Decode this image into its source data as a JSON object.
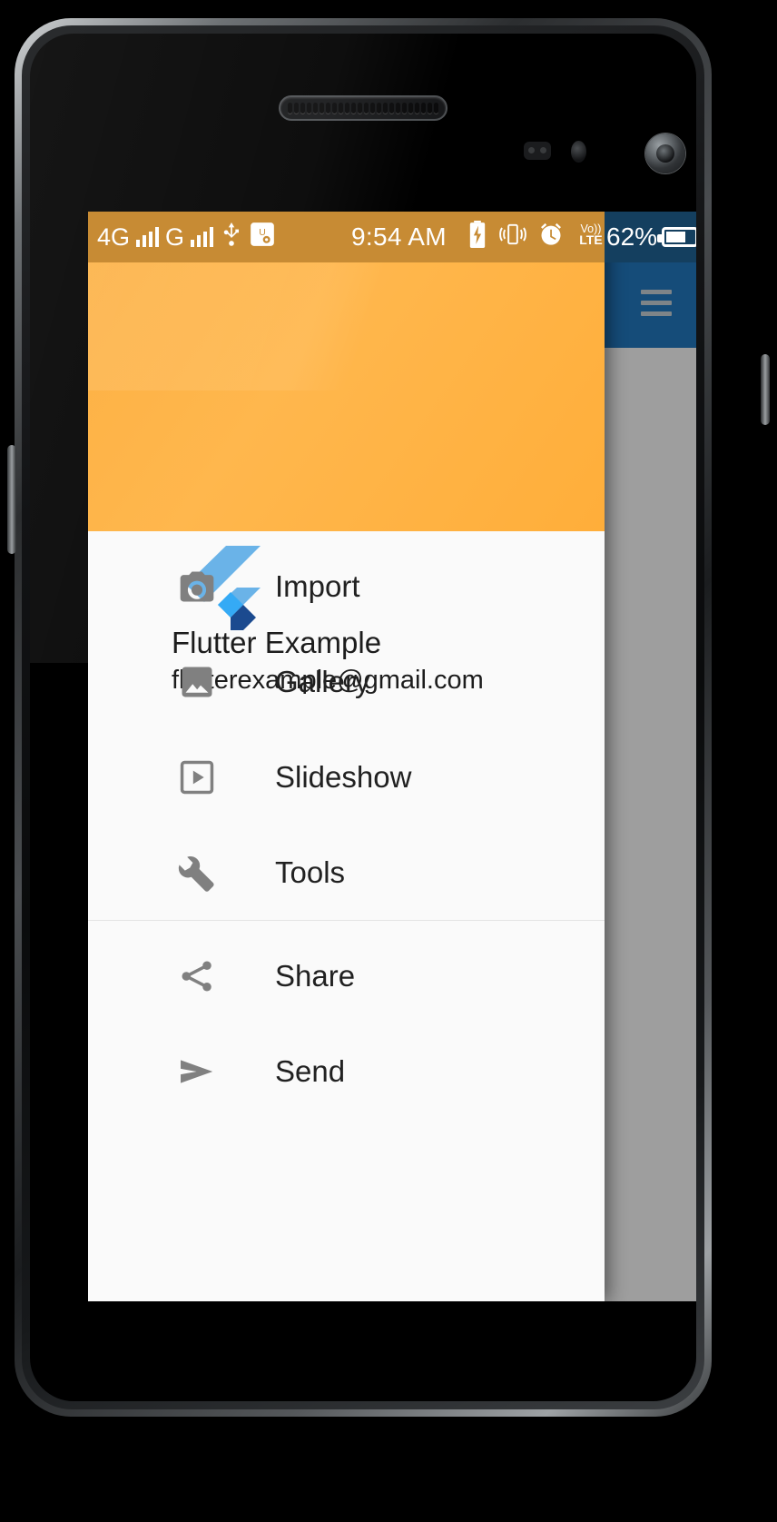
{
  "device": {
    "frame": "android-phone",
    "elements": [
      "earpiece-speaker",
      "proximity-sensor",
      "light-sensor",
      "front-camera"
    ]
  },
  "status_bar": {
    "network_1": "4G",
    "network_2": "G",
    "usb_icon": "usb-icon",
    "usb_debug_icon": "usb-debugging-icon",
    "time": "9:54 AM",
    "charging_icon": "battery-charging-icon",
    "vibrate_icon": "vibrate-icon",
    "alarm_icon": "alarm-clock-icon",
    "volte_top": "Vo))",
    "volte_bottom": "LTE",
    "battery_percent": "62%",
    "battery_level": 62
  },
  "app_bar": {
    "menu_icon": "hamburger-menu-icon",
    "background_color": "#154c79"
  },
  "drawer": {
    "header": {
      "logo": "flutter-logo",
      "name": "Flutter Example",
      "email": "flutterexample@gmail.com",
      "background_color": "#ffb74d"
    },
    "items": [
      {
        "label": "Import",
        "icon": "camera-icon"
      },
      {
        "label": "Gallery",
        "icon": "image-icon"
      },
      {
        "label": "Slideshow",
        "icon": "slideshow-icon"
      },
      {
        "label": "Tools",
        "icon": "wrench-icon"
      }
    ],
    "items_secondary": [
      {
        "label": "Share",
        "icon": "share-icon"
      },
      {
        "label": "Send",
        "icon": "send-icon"
      }
    ]
  }
}
